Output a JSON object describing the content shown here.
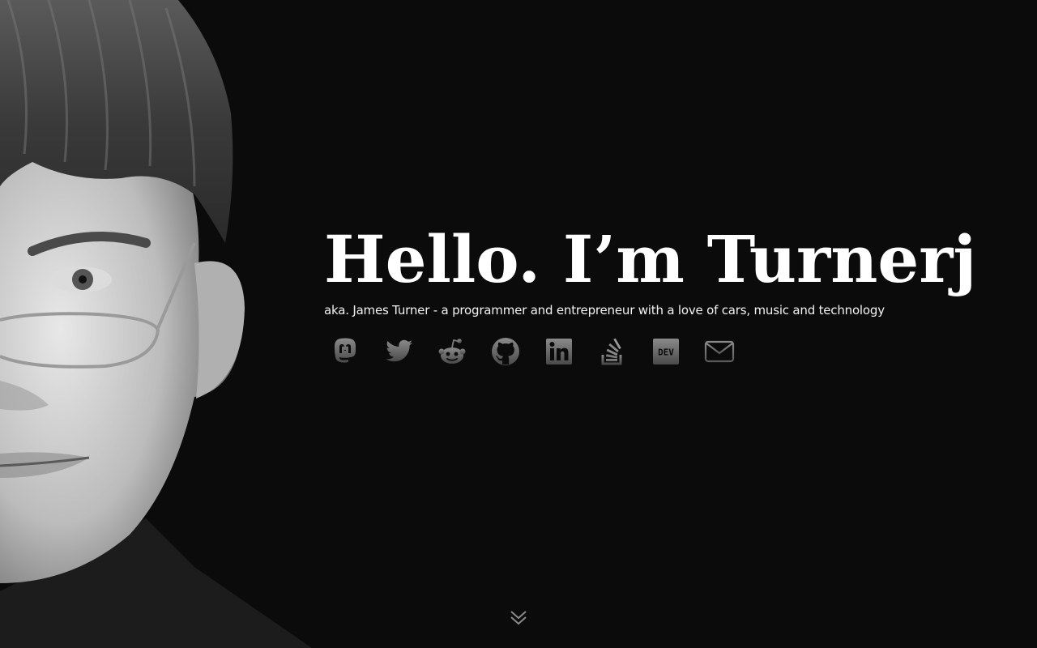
{
  "hero": {
    "title": "Hello. I’m Turnerj",
    "subtitle": "aka. James Turner - a programmer and entrepreneur with a love of cars, music and technology"
  },
  "social_links": [
    {
      "icon": "mastodon-icon"
    },
    {
      "icon": "twitter-icon"
    },
    {
      "icon": "reddit-icon"
    },
    {
      "icon": "github-icon"
    },
    {
      "icon": "linkedin-icon"
    },
    {
      "icon": "stackoverflow-icon"
    },
    {
      "icon": "dev-icon",
      "label": "DEV"
    },
    {
      "icon": "email-icon"
    }
  ],
  "colors": {
    "background": "#0b0b0b",
    "title": "#ffffff",
    "icon_light": "#8a8a8a",
    "icon_dark": "#4a4a4a"
  },
  "scroll": {
    "icon": "double-chevron-down-icon"
  }
}
